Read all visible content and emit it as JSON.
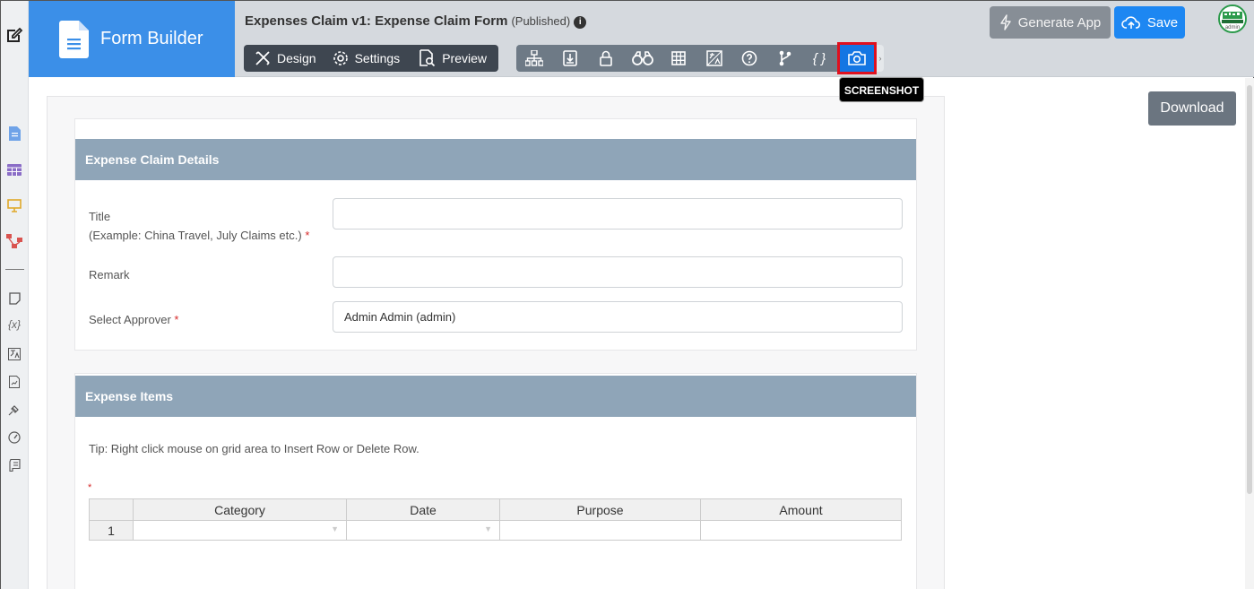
{
  "app": {
    "name": "Form Builder"
  },
  "header": {
    "title": "Expenses Claim v1: Expense Claim Form",
    "status": "(Published)",
    "info_glyph": "i",
    "modes": [
      "Design",
      "Settings",
      "Preview"
    ],
    "toolbar_icons": [
      "tree-icon",
      "download-box-icon",
      "lock-icon",
      "binoculars-icon",
      "grid-icon",
      "translate-icon",
      "help-circle-icon",
      "branch-icon",
      "braces-icon",
      "camera-icon"
    ],
    "braces_glyph": "{ }",
    "more_glyph": "›",
    "active_tooltip": "SCREENSHOT",
    "generate_label": "Generate App",
    "save_label": "Save",
    "avatar_text": "admin"
  },
  "left_rail_icons": [
    "edit-icon",
    "form-icon",
    "datalist-icon",
    "userview-icon",
    "process-icon",
    "note-icon",
    "variable-icon",
    "i18n-icon",
    "report-icon",
    "plugin-icon",
    "performance-icon",
    "log-icon"
  ],
  "left_rail_variable_glyph": "{x}",
  "download_label": "Download",
  "form": {
    "section1": {
      "header": "Expense Claim Details",
      "fields": [
        {
          "label_line1": "Title",
          "label_line2": "(Example: China Travel, July Claims etc.)",
          "required": "*",
          "value": ""
        },
        {
          "label": "Remark",
          "value": ""
        },
        {
          "label": "Select Approver",
          "required": "*",
          "value": "Admin Admin (admin)"
        }
      ]
    },
    "section2": {
      "header": "Expense Items",
      "tip": "Tip: Right click mouse on grid area to Insert Row or Delete Row.",
      "required_mark": "*",
      "grid": {
        "columns": [
          "Category",
          "Date",
          "Purpose",
          "Amount"
        ],
        "rows": [
          {
            "num": "1"
          }
        ],
        "dropdown_glyph": "▼"
      }
    }
  },
  "colors": {
    "brand": "#3b8fe8",
    "save": "#1d87f2",
    "section_header": "#8fa5b8",
    "highlight": "#e0101e"
  }
}
